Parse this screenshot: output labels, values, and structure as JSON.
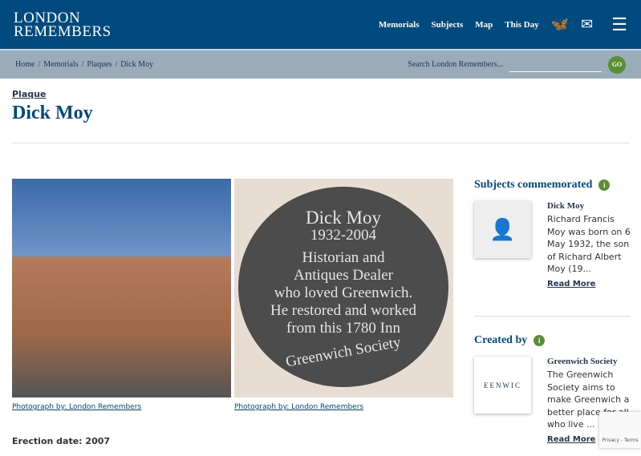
{
  "header": {
    "logo_line1": "LONDON",
    "logo_line2": "REMEMBERS",
    "nav": [
      "Memorials",
      "Subjects",
      "Map",
      "This Day"
    ]
  },
  "breadcrumb": [
    "Home",
    "Memorials",
    "Plaques",
    "Dick Moy"
  ],
  "search": {
    "placeholder": "Search London Remembers...",
    "go": "GO"
  },
  "page": {
    "kind": "Plaque",
    "title": "Dick Moy",
    "erection": "Erection date: 2007"
  },
  "photos": [
    {
      "caption": "Photograph by: London Remembers"
    },
    {
      "caption": "Photograph by: London Remembers",
      "plaque_text": [
        "Dick Moy",
        "1932-2004",
        "Historian and",
        "Antiques Dealer",
        "who loved Greenwich.",
        "He restored and worked",
        "from this 1780 Inn",
        "Greenwich Society"
      ]
    }
  ],
  "subjects": {
    "heading": "Subjects commemorated",
    "name": "Dick Moy",
    "text": "Richard Francis Moy was born on 6 May 1932, the son of Richard Albert Moy (19...",
    "more": "Read More"
  },
  "created": {
    "heading": "Created by",
    "name": "Greenwich Society",
    "text": "The Greenwich Society aims to make Greenwich a better place for all who live ...",
    "more": "Read More"
  },
  "recaptcha": "Privacy - Terms"
}
